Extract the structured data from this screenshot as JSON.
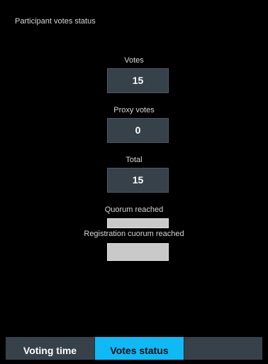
{
  "panel": {
    "title": "Participant votes status"
  },
  "votes": {
    "label": "Votes",
    "value": "15"
  },
  "proxy_votes": {
    "label": "Proxy votes",
    "value": "0"
  },
  "total": {
    "label": "Total",
    "value": "15"
  },
  "quorum": {
    "label": "Quorum reached"
  },
  "registration_quorum": {
    "label": "Registration cuorum reached"
  },
  "tabs": [
    {
      "label": "Voting time",
      "active": false
    },
    {
      "label": "Votes status",
      "active": true
    }
  ],
  "colors": {
    "background": "#000000",
    "value_box": "#36414a",
    "flag_box": "#c9c9c9",
    "active_tab": "#0fb9f5",
    "inactive_tab": "#36414a"
  }
}
